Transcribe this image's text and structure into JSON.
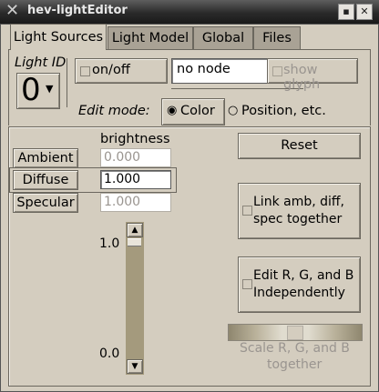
{
  "window": {
    "title": "hev-lightEditor"
  },
  "tabs": [
    "Light Sources",
    "Light Model",
    "Global",
    "Files"
  ],
  "light": {
    "id_label": "Light ID",
    "id_value": "0",
    "on_off_label": "on/off",
    "node_value": "no node",
    "show_glyph_label": "show glyph",
    "edit_mode_label": "Edit mode:",
    "mode_color": "Color",
    "mode_position": "Position, etc."
  },
  "color_panel": {
    "brightness_label": "brightness",
    "rows": [
      {
        "label": "Ambient",
        "value": "0.000",
        "enabled": false
      },
      {
        "label": "Diffuse",
        "value": "1.000",
        "enabled": true
      },
      {
        "label": "Specular",
        "value": "1.000",
        "enabled": false
      }
    ],
    "slider_max_label": "1.0",
    "slider_min_label": "0.0",
    "reset_label": "Reset",
    "link_label_1": "Link amb, diff,",
    "link_label_2": "spec together",
    "edit_rgb_label_1": "Edit R, G, and B",
    "edit_rgb_label_2": "Independently",
    "scale_label_1": "Scale R, G, and B",
    "scale_label_2": "together"
  }
}
